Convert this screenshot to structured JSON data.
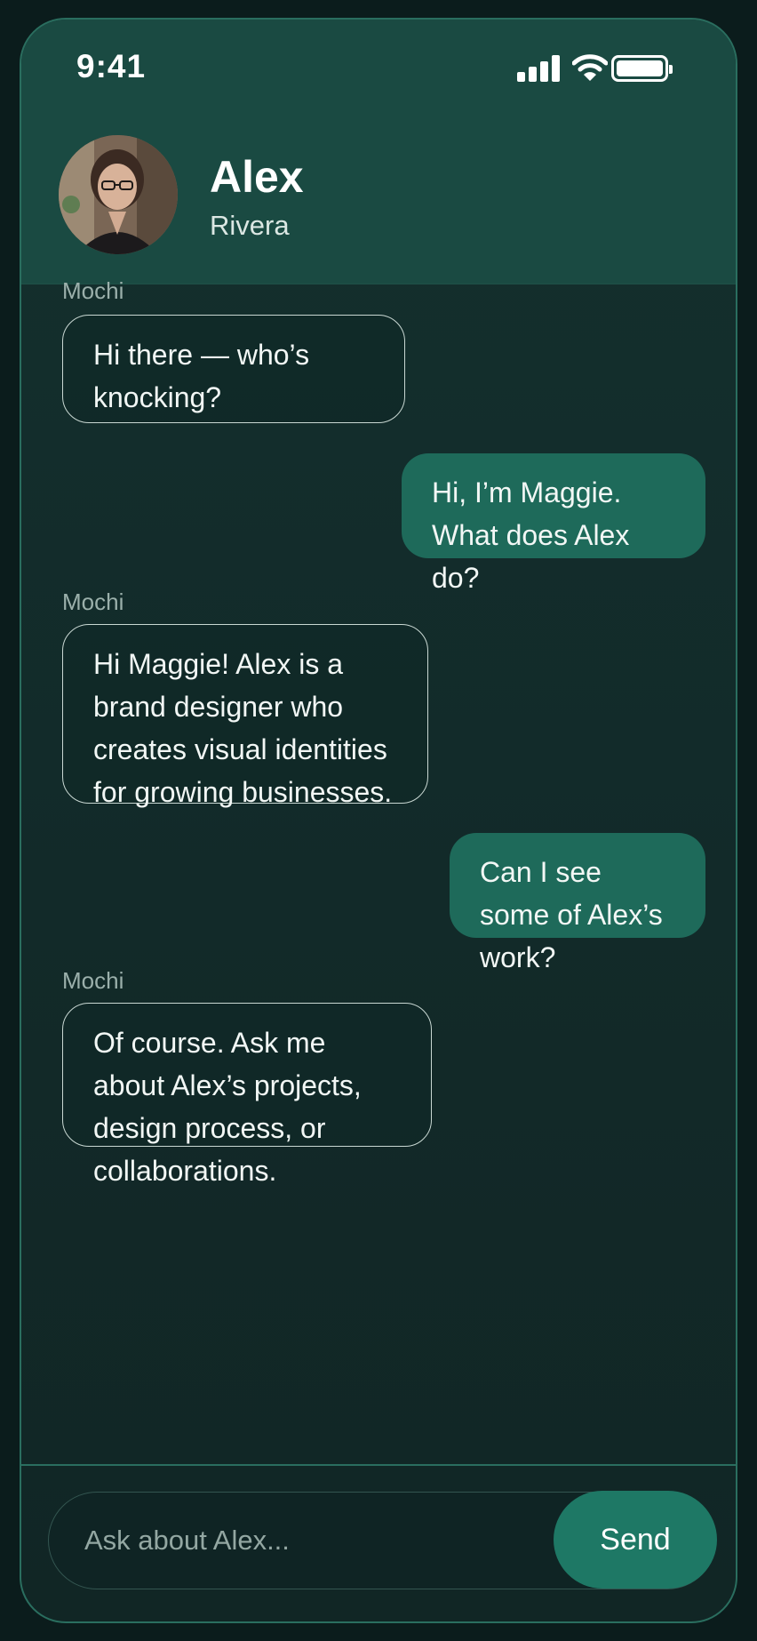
{
  "status_bar": {
    "time": "9:41"
  },
  "contact": {
    "first_name": "Alex",
    "last_name": "Rivera"
  },
  "messages": [
    {
      "sender": "Mochi",
      "text": "Hi there — who’s knocking?"
    },
    {
      "sender": "",
      "text": "Hi, I’m Maggie. What does Alex do?"
    },
    {
      "sender": "Mochi",
      "text": "Hi Maggie! Alex is a brand designer who creates visual identities for growing businesses."
    },
    {
      "sender": "",
      "text": "Can I see some of Alex’s work?"
    },
    {
      "sender": "Mochi",
      "text": "Of course. Ask me about Alex’s projects, design process, or collaborations."
    }
  ],
  "composer": {
    "placeholder": "Ask about Alex...",
    "value": "",
    "send_label": "Send"
  },
  "colors": {
    "accent": "#1e7865",
    "header": "#1a4a42",
    "outgoing_bubble": "#1e6a5a",
    "background": "#122a29"
  },
  "icons": {
    "signal": "signal-icon",
    "wifi": "wifi-icon",
    "battery": "battery-icon"
  }
}
